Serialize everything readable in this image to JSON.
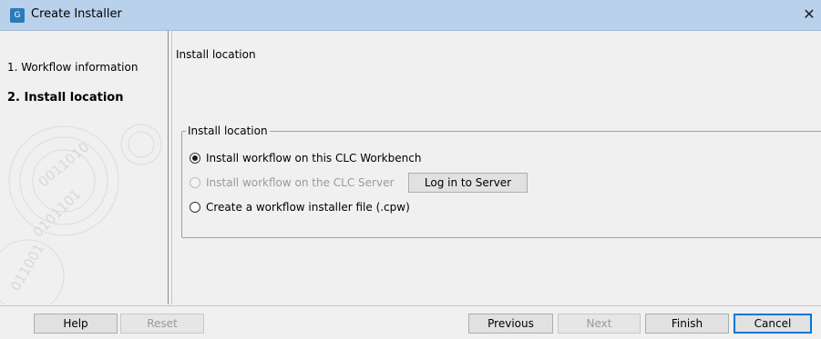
{
  "window": {
    "title": "Create Installer",
    "app_icon": "clc-app-icon",
    "close_glyph": "✕"
  },
  "sidebar": {
    "items": [
      {
        "label": "1.  Workflow information",
        "active": false
      },
      {
        "label": "2.  Install location",
        "active": true
      }
    ]
  },
  "main": {
    "header": "Install location",
    "group": {
      "legend": "Install location",
      "options": [
        {
          "label": "Install workflow on this CLC Workbench",
          "checked": true,
          "disabled": false
        },
        {
          "label": "Install workflow on the CLC Server",
          "checked": false,
          "disabled": true
        },
        {
          "label": "Create a workflow installer file (.cpw)",
          "checked": false,
          "disabled": false
        }
      ],
      "login_button": "Log in to Server"
    }
  },
  "footer": {
    "help": "Help",
    "reset": "Reset",
    "previous": "Previous",
    "next": "Next",
    "finish": "Finish",
    "cancel": "Cancel"
  },
  "colors": {
    "titlebar": "#b9d1ea",
    "background": "#f0f0f0",
    "accent": "#0078d7"
  }
}
